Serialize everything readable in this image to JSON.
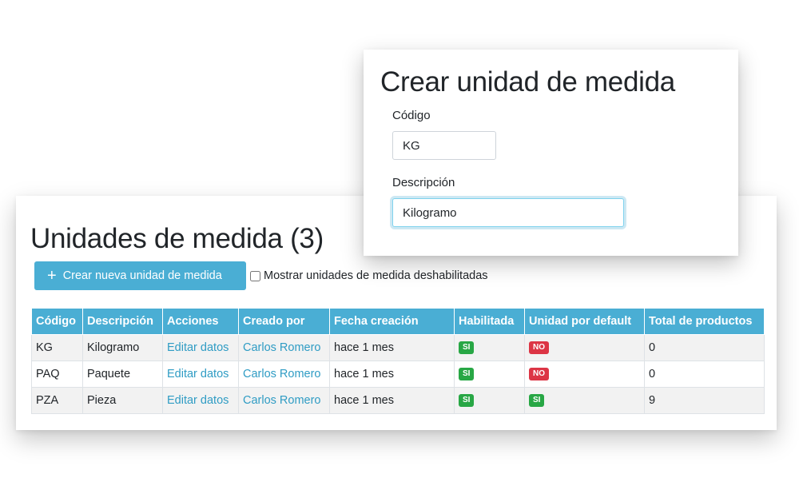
{
  "list": {
    "title": "Unidades de medida (3)",
    "create_button_label": "Crear nueva unidad de medida",
    "show_disabled_label": "Mostrar unidades de medida deshabilitadas",
    "show_disabled_checked": false,
    "columns": [
      "Código",
      "Descripción",
      "Acciones",
      "Creado por",
      "Fecha creación",
      "Habilitada",
      "Unidad por default",
      "Total de productos"
    ],
    "rows": [
      {
        "codigo": "KG",
        "descripcion": "Kilogramo",
        "accion": "Editar datos",
        "creado_por": "Carlos Romero",
        "fecha": "hace 1 mes",
        "habilitada": "SI",
        "por_default": "NO",
        "total": "0"
      },
      {
        "codigo": "PAQ",
        "descripcion": "Paquete",
        "accion": "Editar datos",
        "creado_por": "Carlos Romero",
        "fecha": "hace 1 mes",
        "habilitada": "SI",
        "por_default": "NO",
        "total": "0"
      },
      {
        "codigo": "PZA",
        "descripcion": "Pieza",
        "accion": "Editar datos",
        "creado_por": "Carlos Romero",
        "fecha": "hace 1 mes",
        "habilitada": "SI",
        "por_default": "SI",
        "total": "9"
      }
    ]
  },
  "form": {
    "title": "Crear unidad de medida",
    "codigo_label": "Código",
    "codigo_value": "KG",
    "descripcion_label": "Descripción",
    "descripcion_value": "Kilogramo"
  },
  "colors": {
    "accent": "#4aaed4",
    "link": "#2f9cc4",
    "badge_yes": "#28a745",
    "badge_no": "#dc3545"
  },
  "icons": {
    "create_button": "plus-icon"
  }
}
